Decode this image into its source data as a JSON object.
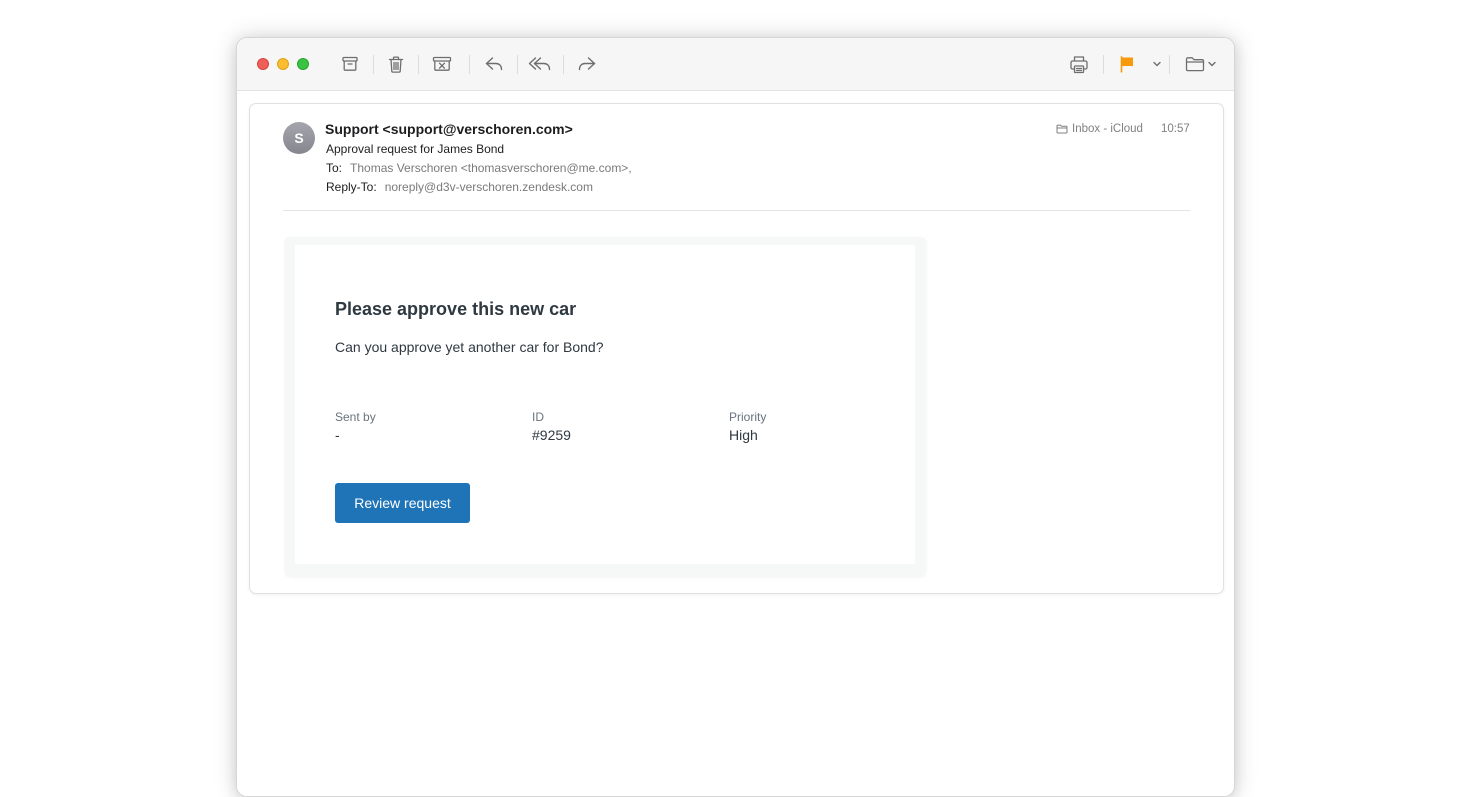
{
  "toolbar": {
    "buttons": [
      {
        "name": "archive-button",
        "icon": "archive-icon"
      },
      {
        "name": "delete-button",
        "icon": "trash-icon"
      },
      {
        "name": "junk-button",
        "icon": "junk-icon"
      },
      {
        "name": "reply-button",
        "icon": "reply-icon"
      },
      {
        "name": "reply-all-button",
        "icon": "reply-all-icon"
      },
      {
        "name": "forward-button",
        "icon": "forward-icon"
      },
      {
        "name": "print-button",
        "icon": "printer-icon"
      },
      {
        "name": "flag-button",
        "icon": "flag-icon"
      },
      {
        "name": "flag-menu-button",
        "icon": "chevron-down-icon"
      },
      {
        "name": "move-button",
        "icon": "folder-icon"
      }
    ],
    "flag_color": "#f7990c"
  },
  "message": {
    "avatar_initial": "S",
    "from": "Support <support@verschoren.com>",
    "subject": "Approval request for James Bond",
    "to_label": "To:",
    "to_value": "Thomas Verschoren <thomasverschoren@me.com>,",
    "reply_to_label": "Reply-To:",
    "reply_to_value": "noreply@d3v-verschoren.zendesk.com",
    "mailbox": "Inbox - iCloud",
    "time": "10:57"
  },
  "email": {
    "title": "Please approve this new car",
    "body": "Can you approve yet another car for Bond?",
    "fields": [
      {
        "label": "Sent by",
        "value": "-"
      },
      {
        "label": "ID",
        "value": "#9259"
      },
      {
        "label": "Priority",
        "value": "High"
      }
    ],
    "button_label": "Review request",
    "button_color": "#1f73b7"
  }
}
